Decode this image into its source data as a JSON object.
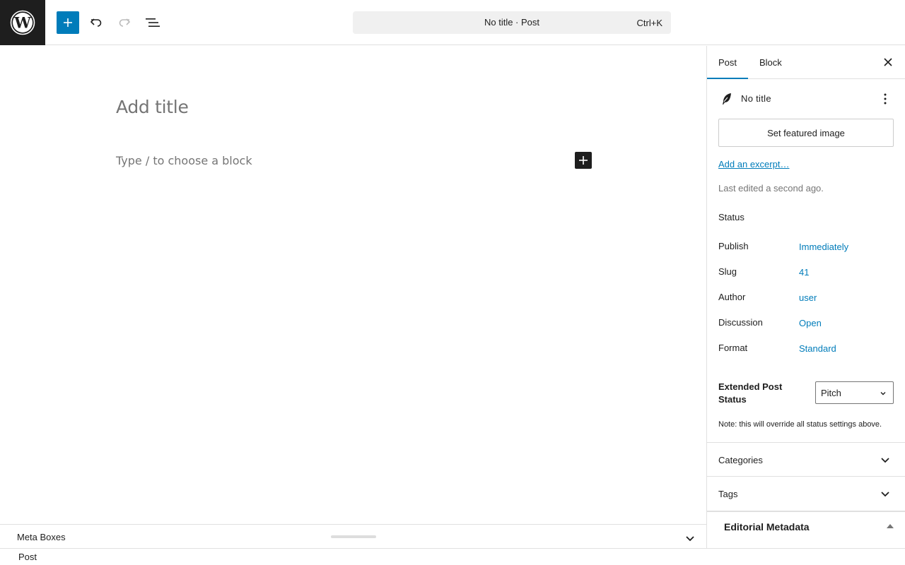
{
  "header": {
    "command_bar_title": "No title · Post",
    "command_bar_shortcut": "Ctrl+K",
    "icons": [
      "wordpress-logo",
      "plus-icon",
      "undo-icon",
      "redo-icon",
      "list-view-icon"
    ],
    "accent_color": "#007cba"
  },
  "editor": {
    "title_placeholder": "Add title",
    "block_placeholder": "Type / to choose a block"
  },
  "metabox": {
    "label": "Meta Boxes"
  },
  "footer": {
    "breadcrumb": "Post"
  },
  "sidebar": {
    "tabs": [
      {
        "label": "Post",
        "active": true
      },
      {
        "label": "Block",
        "active": false
      }
    ],
    "summary_title": "No title",
    "featured_image_button": "Set featured image",
    "excerpt_link": "Add an excerpt…",
    "last_edited": "Last edited a second ago.",
    "status_heading": "Status",
    "rows": [
      {
        "label": "Publish",
        "value": "Immediately"
      },
      {
        "label": "Slug",
        "value": "41"
      },
      {
        "label": "Author",
        "value": "user"
      },
      {
        "label": "Discussion",
        "value": "Open"
      },
      {
        "label": "Format",
        "value": "Standard"
      }
    ],
    "extended_status_label": "Extended Post Status",
    "extended_status_value": "Pitch",
    "note": "Note: this will override all status settings above.",
    "panels": [
      "Categories",
      "Tags"
    ],
    "editorial_metadata": "Editorial Metadata"
  }
}
